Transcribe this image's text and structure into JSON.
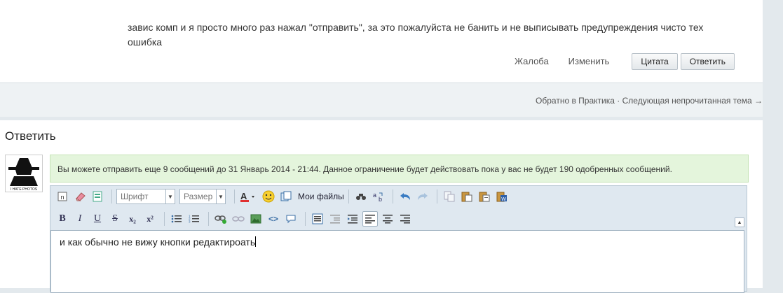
{
  "post": {
    "text": "завис комп и я просто много раз нажал \"отправить\", за это пожалуйста не банить и не выписывать предупреждения чисто тех ошибка",
    "actions": {
      "report": "Жалоба",
      "edit": "Изменить",
      "quote": "Цитата",
      "reply": "Ответить"
    }
  },
  "topic_nav": {
    "back": "Обратно в Практика",
    "separator": "·",
    "next": "Следующая непрочитанная тема →"
  },
  "reply": {
    "title": "Ответить",
    "avatar_text": "I HATE PHOTOS",
    "notice": "Вы можете отправить еще 9 сообщений до 31 Январь 2014 - 21:44. Данное ограничение будет действовать пока у вас не будет 190 одобренных сообщений.",
    "editor": {
      "font_placeholder": "Шрифт",
      "size_placeholder": "Размер",
      "my_files": "Мои файлы",
      "text": "и как обычно не вижу кнопки редактироать",
      "toolbar_row2": [
        "B",
        "I",
        "U",
        "S",
        "x₂",
        "x²"
      ]
    }
  },
  "colors": {
    "notice_bg": "#e4f5dc",
    "editor_bg": "#dfe8f0",
    "page_bg": "#e3e9ed"
  }
}
